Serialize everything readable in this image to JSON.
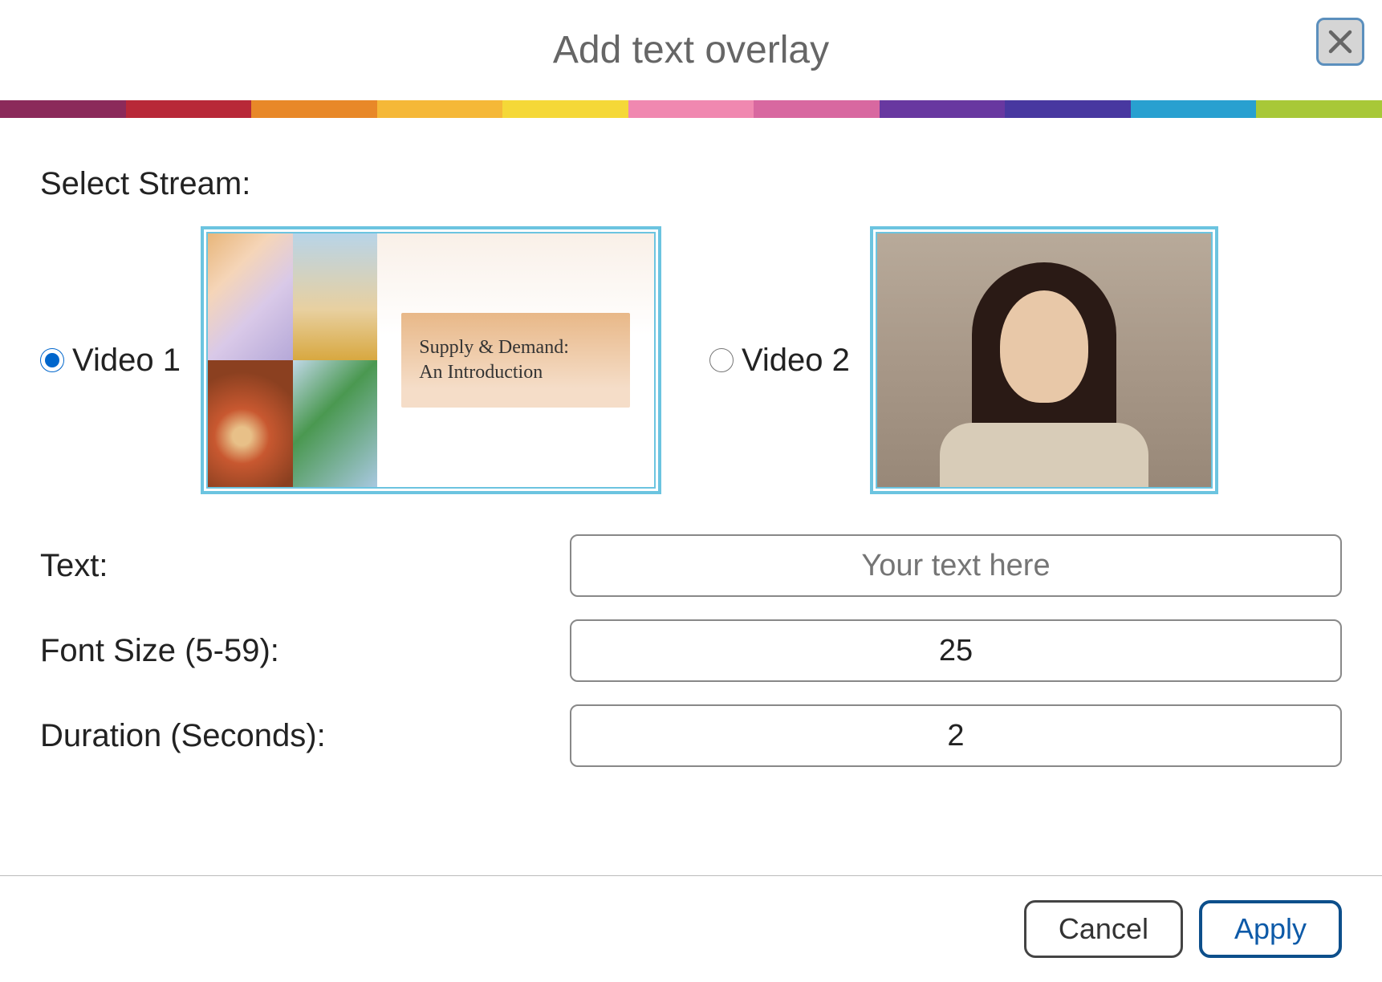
{
  "dialog": {
    "title": "Add text overlay"
  },
  "colorbar": [
    "#8b2a5a",
    "#b82838",
    "#e88828",
    "#f5b838",
    "#f5d838",
    "#f088b0",
    "#d868a0",
    "#6838a0",
    "#4838a0",
    "#28a0d0",
    "#a8c838"
  ],
  "stream": {
    "label": "Select Stream:",
    "options": [
      {
        "label": "Video 1",
        "selected": true
      },
      {
        "label": "Video 2",
        "selected": false
      }
    ],
    "thumb1_title_line1": "Supply & Demand:",
    "thumb1_title_line2": "An Introduction"
  },
  "fields": {
    "text": {
      "label": "Text:",
      "placeholder": "Your text here",
      "value": ""
    },
    "fontsize": {
      "label": "Font Size (5-59):",
      "value": "25"
    },
    "duration": {
      "label": "Duration (Seconds):",
      "value": "2"
    }
  },
  "buttons": {
    "cancel": "Cancel",
    "apply": "Apply"
  }
}
